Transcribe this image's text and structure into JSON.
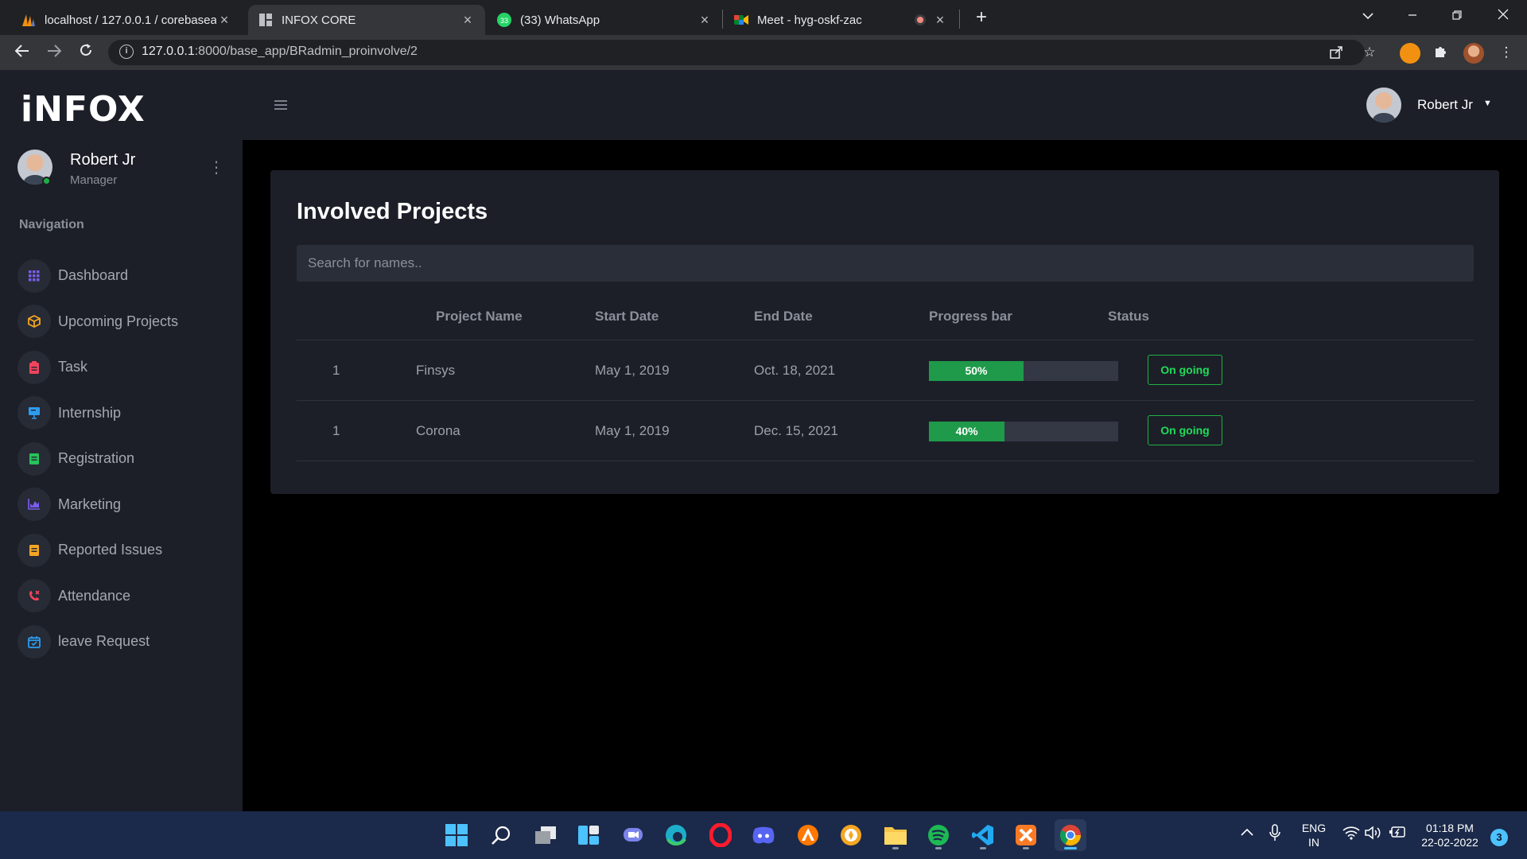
{
  "browser": {
    "tabs": [
      {
        "title": "localhost / 127.0.0.1 / corebaseap",
        "icon": "phpmyadmin-icon"
      },
      {
        "title": "INFOX CORE",
        "icon": "page-icon"
      },
      {
        "title": "(33) WhatsApp",
        "icon": "whatsapp-icon",
        "badge": "33"
      },
      {
        "title": "Meet - hyg-oskf-zac",
        "icon": "meet-icon"
      }
    ],
    "url_host": "127.0.0.1",
    "url_path": ":8000/base_app/BRadmin_proinvolve/2"
  },
  "sidebar": {
    "brand": "iNFOX",
    "user": {
      "name": "Robert Jr",
      "role": "Manager"
    },
    "nav_heading": "Navigation",
    "items": [
      {
        "label": "Dashboard",
        "icon": "grid-icon",
        "color": "#7b5cf0"
      },
      {
        "label": "Upcoming Projects",
        "icon": "cube-icon",
        "color": "#f5a623"
      },
      {
        "label": "Task",
        "icon": "clipboard-icon",
        "color": "#f0445c"
      },
      {
        "label": "Internship",
        "icon": "presentation-icon",
        "color": "#2d9cf0"
      },
      {
        "label": "Registration",
        "icon": "form-icon",
        "color": "#27c25b"
      },
      {
        "label": "Marketing",
        "icon": "chart-icon",
        "color": "#7b5cf0"
      },
      {
        "label": "Reported Issues",
        "icon": "note-icon",
        "color": "#f5a623"
      },
      {
        "label": "Attendance",
        "icon": "phone-icon",
        "color": "#f0445c"
      },
      {
        "label": "leave Request",
        "icon": "calendar-icon",
        "color": "#2d9cf0"
      }
    ]
  },
  "topbar": {
    "user_name": "Robert Jr"
  },
  "main": {
    "title": "Involved Projects",
    "search_placeholder": "Search for names..",
    "columns": [
      "",
      "Project Name",
      "Start Date",
      "End Date",
      "Progress bar",
      "Status"
    ],
    "rows": [
      {
        "no": "1",
        "name": "Finsys",
        "start": "May 1, 2019",
        "end": "Oct. 18, 2021",
        "progress": 50,
        "progress_label": "50%",
        "status": "On going"
      },
      {
        "no": "1",
        "name": "Corona",
        "start": "May 1, 2019",
        "end": "Dec. 15, 2021",
        "progress": 40,
        "progress_label": "40%",
        "status": "On going"
      }
    ]
  },
  "taskbar": {
    "lang_line1": "ENG",
    "lang_line2": "IN",
    "time": "01:18 PM",
    "date": "22-02-2022",
    "notifications": "3"
  }
}
